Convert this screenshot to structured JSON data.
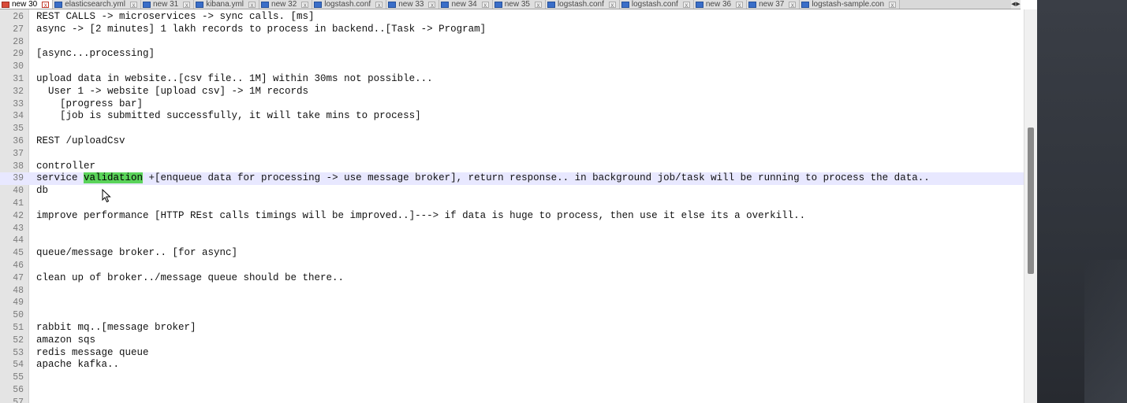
{
  "tabs": [
    {
      "label": "new 30",
      "active": true
    },
    {
      "label": "elasticsearch.yml",
      "active": false
    },
    {
      "label": "new 31",
      "active": false
    },
    {
      "label": "kibana.yml",
      "active": false
    },
    {
      "label": "new 32",
      "active": false
    },
    {
      "label": "logstash.conf",
      "active": false
    },
    {
      "label": "new 33",
      "active": false
    },
    {
      "label": "new 34",
      "active": false
    },
    {
      "label": "new 35",
      "active": false
    },
    {
      "label": "logstash.conf",
      "active": false
    },
    {
      "label": "logstash.conf",
      "active": false
    },
    {
      "label": "new 36",
      "active": false
    },
    {
      "label": "new 37",
      "active": false
    },
    {
      "label": "logstash-sample.con",
      "active": false
    }
  ],
  "tab_close_glyph": "x",
  "tab_nav": {
    "prev": "◀",
    "next": "▶"
  },
  "editor": {
    "lines": [
      {
        "num": "26",
        "text": "REST CALLS -> microservices -> sync calls. [ms]"
      },
      {
        "num": "27",
        "text": "async -> [2 minutes] 1 lakh records to process in backend..[Task -> Program]"
      },
      {
        "num": "28",
        "text": ""
      },
      {
        "num": "29",
        "text": "[async...processing]"
      },
      {
        "num": "30",
        "text": ""
      },
      {
        "num": "31",
        "text": "upload data in website..[csv file.. 1M] within 30ms not possible..."
      },
      {
        "num": "32",
        "text": "  User 1 -> website [upload csv] -> 1M records"
      },
      {
        "num": "33",
        "text": "    [progress bar]"
      },
      {
        "num": "34",
        "text": "    [job is submitted successfully, it will take mins to process]"
      },
      {
        "num": "35",
        "text": ""
      },
      {
        "num": "36",
        "text": "REST /uploadCsv"
      },
      {
        "num": "37",
        "text": ""
      },
      {
        "num": "38",
        "text": "controller"
      },
      {
        "num": "39",
        "text": "",
        "current": true,
        "pre": "service ",
        "highlight": "validation",
        "post": " +[enqueue data for processing -> use message broker], return response.. in background job/task will be running to process the data.."
      },
      {
        "num": "40",
        "text": "db"
      },
      {
        "num": "41",
        "text": ""
      },
      {
        "num": "42",
        "text": "improve performance [HTTP REst calls timings will be improved..]---> if data is huge to process, then use it else its a overkill.."
      },
      {
        "num": "43",
        "text": ""
      },
      {
        "num": "44",
        "text": ""
      },
      {
        "num": "45",
        "text": "queue/message broker.. [for async]"
      },
      {
        "num": "46",
        "text": ""
      },
      {
        "num": "47",
        "text": "clean up of broker../message queue should be there.."
      },
      {
        "num": "48",
        "text": ""
      },
      {
        "num": "49",
        "text": ""
      },
      {
        "num": "50",
        "text": ""
      },
      {
        "num": "51",
        "text": "rabbit mq..[message broker]"
      },
      {
        "num": "52",
        "text": "amazon sqs"
      },
      {
        "num": "53",
        "text": "redis message queue"
      },
      {
        "num": "54",
        "text": "apache kafka.."
      },
      {
        "num": "55",
        "text": ""
      },
      {
        "num": "56",
        "text": ""
      },
      {
        "num": "57",
        "text": ""
      }
    ]
  },
  "colors": {
    "highlight": "#5ad35a",
    "current_line": "#e8e8ff",
    "gutter": "#e4e4e4",
    "side_panel": "#2f333a"
  }
}
